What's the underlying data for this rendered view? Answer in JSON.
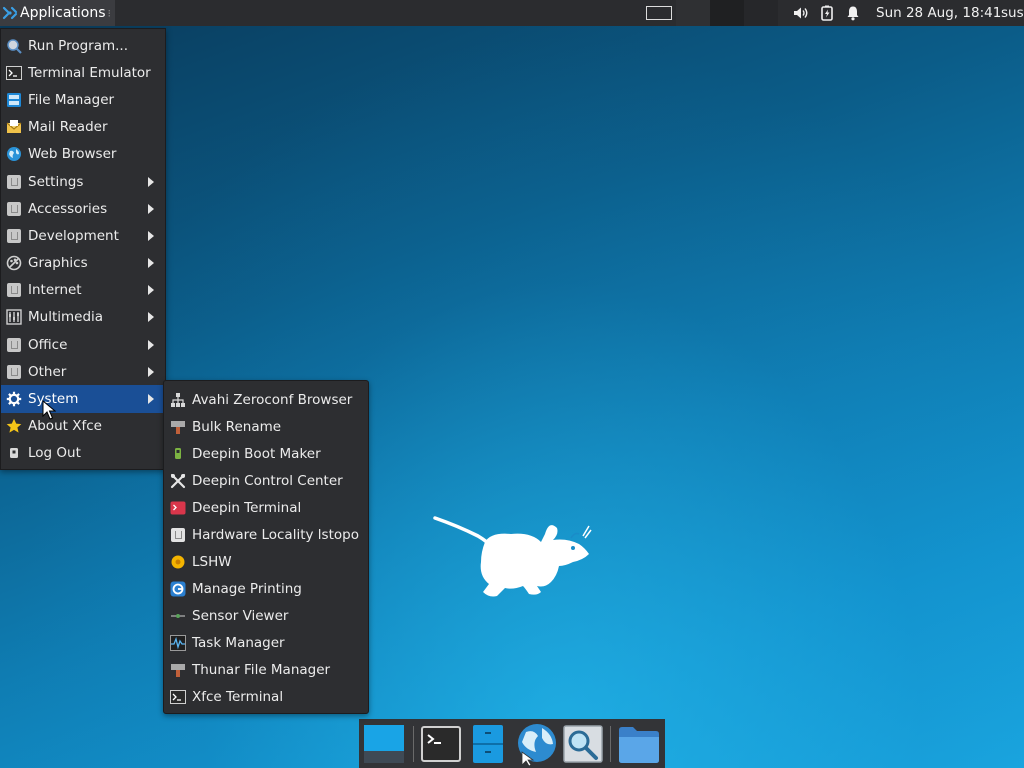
{
  "top_panel": {
    "applications_label": "Applications",
    "clock": "Sun 28 Aug, 18:41",
    "user": "sus"
  },
  "main_menu": {
    "items": [
      {
        "label": "Run Program...",
        "icon": "run-program-icon",
        "submenu": false
      },
      {
        "label": "Terminal Emulator",
        "icon": "terminal-icon",
        "submenu": false
      },
      {
        "label": "File Manager",
        "icon": "file-manager-icon",
        "submenu": false
      },
      {
        "label": "Mail Reader",
        "icon": "mail-icon",
        "submenu": false
      },
      {
        "label": "Web Browser",
        "icon": "web-browser-icon",
        "submenu": false
      },
      {
        "label": "Settings",
        "icon": "settings-icon",
        "submenu": true
      },
      {
        "label": "Accessories",
        "icon": "accessories-icon",
        "submenu": true
      },
      {
        "label": "Development",
        "icon": "development-icon",
        "submenu": true
      },
      {
        "label": "Graphics",
        "icon": "graphics-icon",
        "submenu": true
      },
      {
        "label": "Internet",
        "icon": "internet-icon",
        "submenu": true
      },
      {
        "label": "Multimedia",
        "icon": "multimedia-icon",
        "submenu": true
      },
      {
        "label": "Office",
        "icon": "office-icon",
        "submenu": true
      },
      {
        "label": "Other",
        "icon": "other-icon",
        "submenu": true
      },
      {
        "label": "System",
        "icon": "gear-icon",
        "submenu": true,
        "active": true
      },
      {
        "label": "About Xfce",
        "icon": "star-icon",
        "submenu": false
      },
      {
        "label": "Log Out",
        "icon": "logout-icon",
        "submenu": false
      }
    ]
  },
  "system_submenu": {
    "items": [
      {
        "label": "Avahi Zeroconf Browser",
        "icon": "network-icon"
      },
      {
        "label": "Bulk Rename",
        "icon": "bulk-rename-icon"
      },
      {
        "label": "Deepin Boot Maker",
        "icon": "boot-maker-icon"
      },
      {
        "label": "Deepin Control Center",
        "icon": "tools-icon"
      },
      {
        "label": "Deepin Terminal",
        "icon": "deepin-terminal-icon"
      },
      {
        "label": "Hardware Locality lstopo",
        "icon": "lstopo-icon"
      },
      {
        "label": "LSHW",
        "icon": "lshw-icon"
      },
      {
        "label": "Manage Printing",
        "icon": "printing-icon"
      },
      {
        "label": "Sensor Viewer",
        "icon": "sensor-icon"
      },
      {
        "label": "Task Manager",
        "icon": "task-manager-icon"
      },
      {
        "label": "Thunar File Manager",
        "icon": "thunar-icon"
      },
      {
        "label": "Xfce Terminal",
        "icon": "xfce-terminal-icon"
      }
    ]
  },
  "dock": {
    "items": [
      {
        "icon": "show-desktop-icon"
      },
      {
        "icon": "terminal-icon"
      },
      {
        "icon": "file-manager-icon"
      },
      {
        "icon": "web-browser-icon"
      },
      {
        "icon": "app-finder-icon"
      },
      {
        "icon": "folder-icon"
      }
    ]
  },
  "colors": {
    "panel": "#2b2c2f",
    "menu_bg": "#2d2e31",
    "highlight": "#1a4f96",
    "desktop": "#0f7db3"
  }
}
